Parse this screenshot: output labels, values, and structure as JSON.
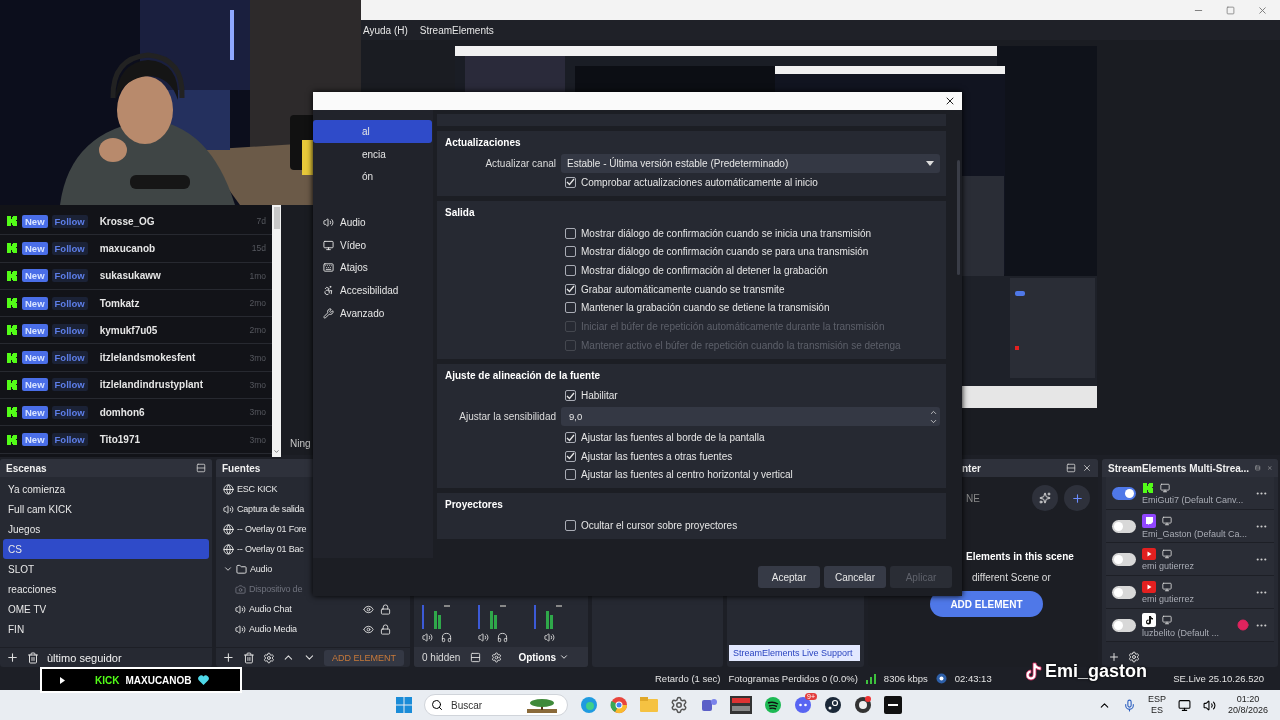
{
  "obs_window": {
    "menu": [
      "Ayuda (H)",
      "StreamElements"
    ],
    "preview_label": "Ning"
  },
  "followers": [
    {
      "badge": "New",
      "action": "Follow",
      "name": "Krosse_OG",
      "age": "7d"
    },
    {
      "badge": "New",
      "action": "Follow",
      "name": "maxucanob",
      "age": "15d"
    },
    {
      "badge": "New",
      "action": "Follow",
      "name": "sukasukaww",
      "age": "1mo"
    },
    {
      "badge": "New",
      "action": "Follow",
      "name": "Tomkatz",
      "age": "2mo"
    },
    {
      "badge": "New",
      "action": "Follow",
      "name": "kymukf7u05",
      "age": "2mo"
    },
    {
      "badge": "New",
      "action": "Follow",
      "name": "itzlelandsmokesfent",
      "age": "3mo"
    },
    {
      "badge": "New",
      "action": "Follow",
      "name": "itzlelandindrustyplant",
      "age": "3mo"
    },
    {
      "badge": "New",
      "action": "Follow",
      "name": "domhon6",
      "age": "3mo"
    },
    {
      "badge": "New",
      "action": "Follow",
      "name": "Tito1971",
      "age": "3mo"
    }
  ],
  "settings_dialog": {
    "sidebar": [
      {
        "label": "al",
        "selected": true
      },
      {
        "label": "encia",
        "selected": false
      },
      {
        "label": "ón",
        "selected": false
      },
      {
        "label": "Audio",
        "selected": false
      },
      {
        "label": "Vídeo",
        "selected": false
      },
      {
        "label": "Atajos",
        "selected": false
      },
      {
        "label": "Accesibilidad",
        "selected": false
      },
      {
        "label": "Avanzado",
        "selected": false
      }
    ],
    "sections": [
      {
        "title": "Actualizaciones",
        "rows": [
          {
            "kind": "select",
            "label": "Actualizar canal",
            "value": "Estable - Última versión estable (Predeterminado)"
          },
          {
            "kind": "checkbox",
            "label": "Comprobar actualizaciones automáticamente al inicio",
            "checked": true,
            "disabled": false
          }
        ]
      },
      {
        "title": "Salida",
        "rows": [
          {
            "kind": "checkbox",
            "label": "Mostrar diálogo de confirmación cuando se inicia una transmisión",
            "checked": false,
            "disabled": false
          },
          {
            "kind": "checkbox",
            "label": "Mostrar diálogo de confirmación cuando se para una transmisión",
            "checked": false,
            "disabled": false
          },
          {
            "kind": "checkbox",
            "label": "Mostrar diálogo de confirmación al detener la grabación",
            "checked": false,
            "disabled": false
          },
          {
            "kind": "checkbox",
            "label": "Grabar automáticamente cuando se transmite",
            "checked": true,
            "disabled": false
          },
          {
            "kind": "checkbox",
            "label": "Mantener la grabación cuando se detiene la transmisión",
            "checked": false,
            "disabled": false
          },
          {
            "kind": "checkbox",
            "label": "Iniciar el búfer de repetición automáticamente durante la transmisión",
            "checked": false,
            "disabled": true
          },
          {
            "kind": "checkbox",
            "label": "Mantener activo el búfer de repetición cuando la transmisión se detenga",
            "checked": false,
            "disabled": true
          }
        ]
      },
      {
        "title": "Ajuste de alineación de la fuente",
        "rows": [
          {
            "kind": "checkbox",
            "label": "Habilitar",
            "checked": true,
            "disabled": false
          },
          {
            "kind": "spin",
            "label": "Ajustar la sensibilidad",
            "value": "9,0"
          },
          {
            "kind": "checkbox",
            "label": "Ajustar las fuentes al borde de la pantalla",
            "checked": true,
            "disabled": false
          },
          {
            "kind": "checkbox",
            "label": "Ajustar las fuentes a otras fuentes",
            "checked": true,
            "disabled": false
          },
          {
            "kind": "checkbox",
            "label": "Ajustar las fuentes al centro horizontal y vertical",
            "checked": false,
            "disabled": false
          }
        ]
      },
      {
        "title": "Proyectores",
        "rows": [
          {
            "kind": "checkbox",
            "label": "Ocultar el cursor sobre proyectores",
            "checked": false,
            "disabled": false
          }
        ]
      }
    ],
    "buttons": [
      {
        "label": "Aceptar",
        "disabled": false
      },
      {
        "label": "Cancelar",
        "disabled": false
      },
      {
        "label": "Aplicar",
        "disabled": true
      }
    ]
  },
  "scenes": {
    "title": "Escenas",
    "items": [
      {
        "label": "Ya comienza",
        "selected": false
      },
      {
        "label": "Full cam KICK",
        "selected": false
      },
      {
        "label": "Juegos",
        "selected": false
      },
      {
        "label": "CS",
        "selected": true
      },
      {
        "label": "SLOT",
        "selected": false
      },
      {
        "label": "reacciones",
        "selected": false
      },
      {
        "label": "OME TV",
        "selected": false
      },
      {
        "label": "FIN",
        "selected": false
      }
    ],
    "overlay_text": "ùltimo seguidor"
  },
  "sources": {
    "title": "Fuentes",
    "items": [
      {
        "kind": "browser",
        "label": "ESC KICK"
      },
      {
        "kind": "audio",
        "label": "Captura de salida"
      },
      {
        "kind": "browser",
        "label": "-- Overlay 01 Fore"
      },
      {
        "kind": "browser",
        "label": "-- Overlay 01 Bac"
      },
      {
        "kind": "group",
        "label": "Audio",
        "expanded": true,
        "children": [
          {
            "kind": "camera",
            "label": "Dispositivo de",
            "disabled": true
          },
          {
            "kind": "audio",
            "label": "Audio Chat",
            "disabled": false,
            "eye_shown": true
          },
          {
            "kind": "audio",
            "label": "Audio Media",
            "disabled": false,
            "eye_shown": true
          }
        ]
      }
    ],
    "add_element": "ADD ELEMENT"
  },
  "mixer": {
    "hidden_count": "0 hidden",
    "options": "Options"
  },
  "live_support": "StreamElements Live Support",
  "scene_elements": {
    "title": "nter",
    "label": "NE",
    "heading": "Elements in this scene",
    "hint": "different Scene or",
    "button": "ADD ELEMENT"
  },
  "multistream": {
    "title": "StreamElements Multi-Strea...",
    "outputs": [
      {
        "kind": "kick",
        "on": true,
        "name": "EmiGuti7 (Default Canv...",
        "alert": false
      },
      {
        "kind": "twitch",
        "on": false,
        "name": "Emi_Gaston (Default Ca...",
        "alert": false
      },
      {
        "kind": "youtube",
        "on": false,
        "name": "emi gutierrez",
        "alert": false
      },
      {
        "kind": "youtube",
        "on": false,
        "name": "emi gutierrez",
        "alert": false
      },
      {
        "kind": "tiktok",
        "on": false,
        "name": "luzbelito (Default ...",
        "alert": true
      }
    ]
  },
  "status_bar": [
    {
      "kind": "text",
      "text": "Retardo (1 sec)"
    },
    {
      "kind": "text",
      "text": "Fotogramas Perdidos 0 (0.0%)"
    },
    {
      "kind": "signal",
      "text": "8306 kbps"
    },
    {
      "kind": "live",
      "text": "02:43:13"
    },
    {
      "kind": "version",
      "text": "SE.Live 25.10.26.520"
    }
  ],
  "taskbar": {
    "search_placeholder": "Buscar",
    "chat_badge": "9+",
    "language": [
      "ESP",
      "ES"
    ],
    "time": "01:20",
    "date": "20/8/2026"
  },
  "kick_banner": {
    "platform": "KICK",
    "name": "MAXUCANOB"
  },
  "stream_overlay": {
    "name": "Emi_gaston"
  }
}
